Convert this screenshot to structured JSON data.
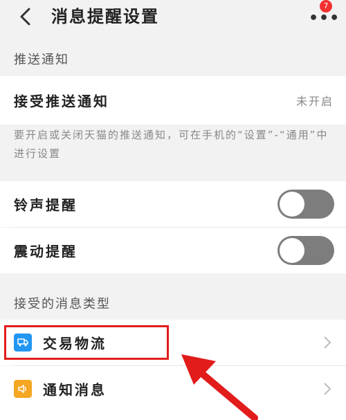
{
  "header": {
    "title": "消息提醒设置",
    "badge_count": "7"
  },
  "push_section": {
    "label": "推送通知",
    "accept_push_label": "接受推送通知",
    "accept_push_value": "未开启",
    "hint": "要开启或关闭天猫的推送通知，可在手机的“设置”-“通用”中进行设置"
  },
  "alerts": {
    "ringtone_label": "铃声提醒",
    "ringtone_on": false,
    "vibrate_label": "震动提醒",
    "vibrate_on": false
  },
  "types_section": {
    "label": "接受的消息类型",
    "items": [
      {
        "label": "交易物流",
        "icon": "truck-icon",
        "color": "#2196f3"
      },
      {
        "label": "通知消息",
        "icon": "speaker-icon",
        "color": "#f5a623"
      }
    ]
  },
  "colors": {
    "annotation": "#e21b1b",
    "toggle_off": "#7d7d7d",
    "badge": "#f23030"
  }
}
